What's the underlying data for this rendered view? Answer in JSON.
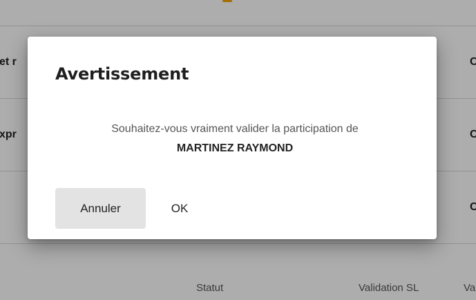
{
  "background": {
    "rows": [
      {
        "left_text": "et r",
        "right_text": "C"
      },
      {
        "left_text": "xpr",
        "right_text": "C"
      },
      {
        "left_text": "",
        "right_text": "C"
      }
    ],
    "table_headers": {
      "statut": "Statut",
      "validation_sl": "Validation SL",
      "cut_off": "Va"
    },
    "colors": {
      "accent": "#f0a400"
    }
  },
  "dialog": {
    "title": "Avertissement",
    "message": "Souhaitez-vous vraiment valider la participation de",
    "participant_name": "MARTINEZ RAYMOND",
    "cancel_label": "Annuler",
    "ok_label": "OK"
  }
}
